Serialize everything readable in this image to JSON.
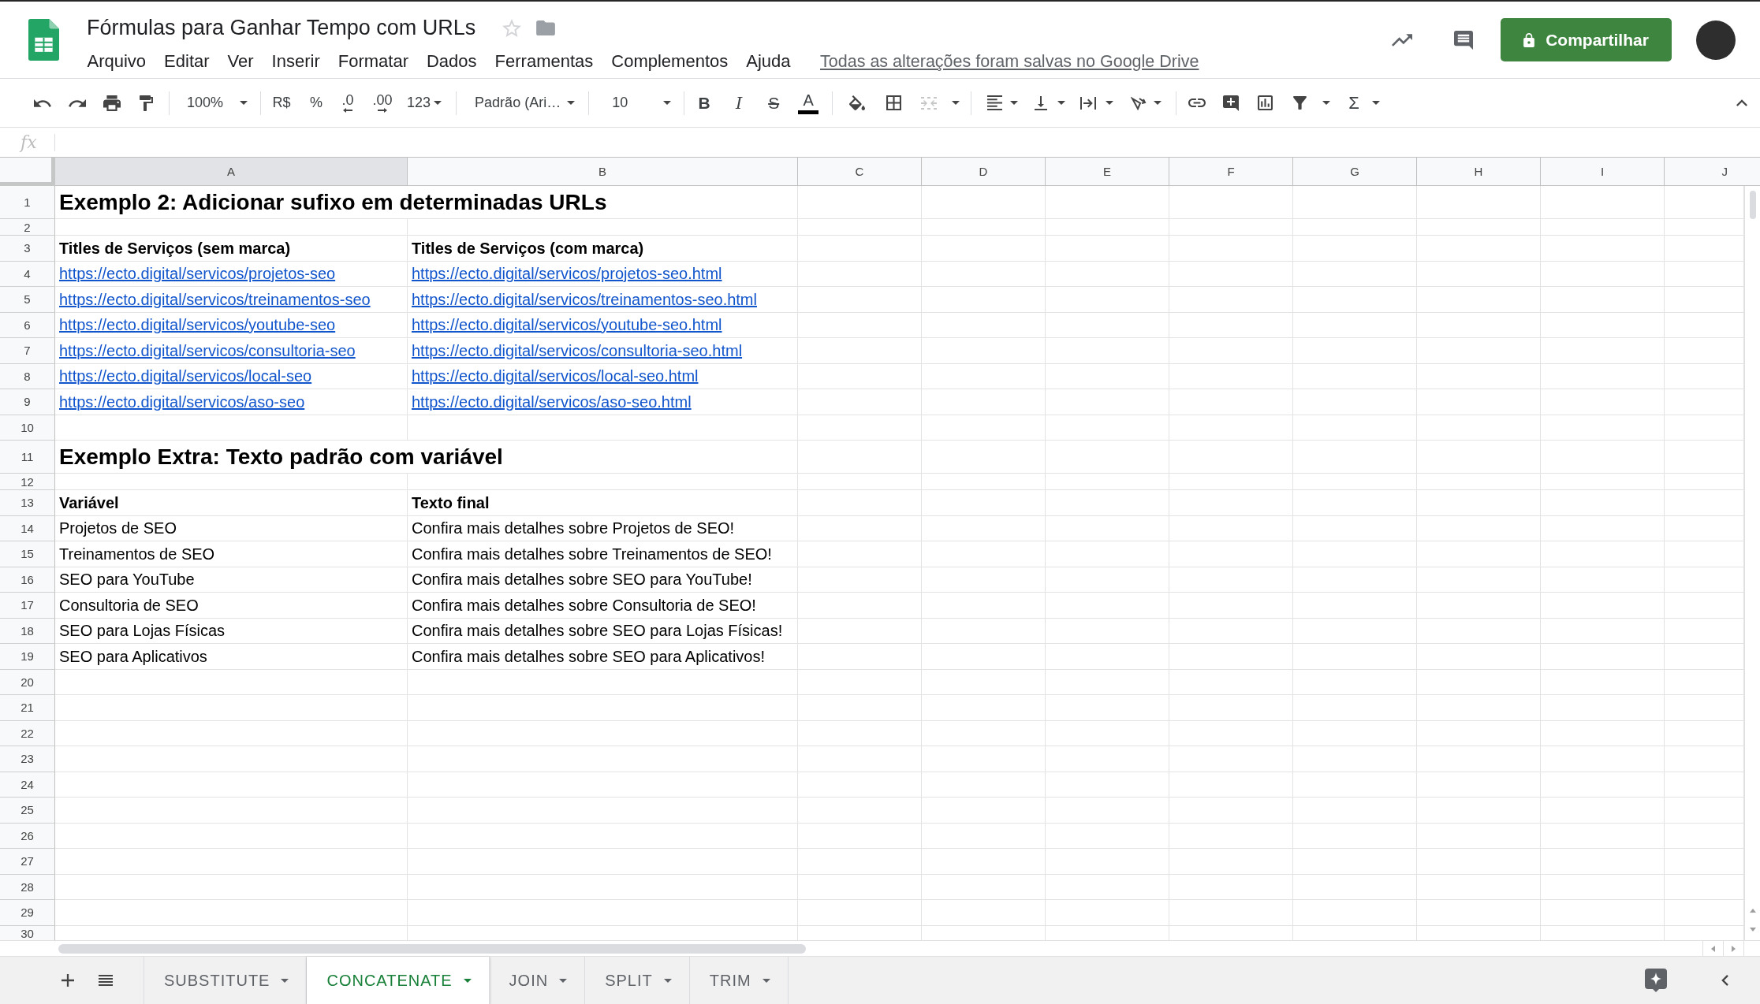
{
  "document": {
    "title": "Fórmulas para Ganhar Tempo com URLs",
    "starred": false,
    "menu": [
      "Arquivo",
      "Editar",
      "Ver",
      "Inserir",
      "Formatar",
      "Dados",
      "Ferramentas",
      "Complementos",
      "Ajuda"
    ],
    "save_status": "Todas as alterações foram salvas no Google Drive"
  },
  "share_button": {
    "label": "Compartilhar"
  },
  "toolbar": {
    "zoom": "100%",
    "currency": "R$",
    "percent": "%",
    "decrease_decimals": ".0",
    "increase_decimals": ".00",
    "number_format": "123",
    "font": "Padrão (Ari…",
    "font_size": "10",
    "bold": "B",
    "italic": "I",
    "strikethrough": "S",
    "text_color": "A",
    "merge_cells": {
      "disabled": true
    },
    "functions": "Σ"
  },
  "formula_bar": {
    "label": "fx"
  },
  "sheet": {
    "columns": [
      {
        "label": "A",
        "selected": true
      },
      {
        "label": "B",
        "selected": false
      },
      {
        "label": "C",
        "selected": false
      },
      {
        "label": "D",
        "selected": false
      },
      {
        "label": "E",
        "selected": false
      },
      {
        "label": "F",
        "selected": false
      },
      {
        "label": "G",
        "selected": false
      },
      {
        "label": "H",
        "selected": false
      },
      {
        "label": "I",
        "selected": false
      },
      {
        "label": "J",
        "selected": false
      }
    ],
    "rows": [
      {
        "number": "1",
        "kind": "title",
        "cells": [
          {
            "kind": "title",
            "text": "Exemplo 2: Adicionar sufixo em determinadas URLs"
          }
        ]
      },
      {
        "number": "2",
        "kind": "spacer"
      },
      {
        "number": "3",
        "kind": "data",
        "cells": [
          {
            "kind": "bold",
            "text": "Titles de Serviços (sem marca)"
          },
          {
            "kind": "bold",
            "text": "Titles de Serviços (com marca)"
          }
        ]
      },
      {
        "number": "4",
        "kind": "data",
        "cells": [
          {
            "kind": "link",
            "text": "https://ecto.digital/servicos/projetos-seo"
          },
          {
            "kind": "link",
            "text": "https://ecto.digital/servicos/projetos-seo.html"
          }
        ]
      },
      {
        "number": "5",
        "kind": "data",
        "cells": [
          {
            "kind": "link",
            "text": "https://ecto.digital/servicos/treinamentos-seo"
          },
          {
            "kind": "link",
            "text": "https://ecto.digital/servicos/treinamentos-seo.html"
          }
        ]
      },
      {
        "number": "6",
        "kind": "data",
        "cells": [
          {
            "kind": "link",
            "text": "https://ecto.digital/servicos/youtube-seo"
          },
          {
            "kind": "link",
            "text": "https://ecto.digital/servicos/youtube-seo.html"
          }
        ]
      },
      {
        "number": "7",
        "kind": "data",
        "cells": [
          {
            "kind": "link",
            "text": "https://ecto.digital/servicos/consultoria-seo"
          },
          {
            "kind": "link",
            "text": "https://ecto.digital/servicos/consultoria-seo.html"
          }
        ]
      },
      {
        "number": "8",
        "kind": "data",
        "cells": [
          {
            "kind": "link",
            "text": "https://ecto.digital/servicos/local-seo"
          },
          {
            "kind": "link",
            "text": "https://ecto.digital/servicos/local-seo.html"
          }
        ]
      },
      {
        "number": "9",
        "kind": "data",
        "cells": [
          {
            "kind": "link",
            "text": "https://ecto.digital/servicos/aso-seo"
          },
          {
            "kind": "link",
            "text": "https://ecto.digital/servicos/aso-seo.html"
          }
        ]
      },
      {
        "number": "10",
        "kind": "data"
      },
      {
        "number": "11",
        "kind": "title",
        "cells": [
          {
            "kind": "title",
            "text": "Exemplo Extra: Texto padrão com variável"
          }
        ]
      },
      {
        "number": "12",
        "kind": "spacer"
      },
      {
        "number": "13",
        "kind": "data",
        "cells": [
          {
            "kind": "bold",
            "text": "Variável"
          },
          {
            "kind": "bold",
            "text": "Texto final"
          }
        ]
      },
      {
        "number": "14",
        "kind": "data",
        "cells": [
          {
            "kind": "text",
            "text": "Projetos de SEO"
          },
          {
            "kind": "text",
            "text": "Confira mais detalhes sobre Projetos de SEO!"
          }
        ]
      },
      {
        "number": "15",
        "kind": "data",
        "cells": [
          {
            "kind": "text",
            "text": "Treinamentos de SEO"
          },
          {
            "kind": "text",
            "text": "Confira mais detalhes sobre Treinamentos de SEO!"
          }
        ]
      },
      {
        "number": "16",
        "kind": "data",
        "cells": [
          {
            "kind": "text",
            "text": "SEO para YouTube"
          },
          {
            "kind": "text",
            "text": "Confira mais detalhes sobre SEO para YouTube!"
          }
        ]
      },
      {
        "number": "17",
        "kind": "data",
        "cells": [
          {
            "kind": "text",
            "text": "Consultoria de SEO"
          },
          {
            "kind": "text",
            "text": "Confira mais detalhes sobre Consultoria de SEO!"
          }
        ]
      },
      {
        "number": "18",
        "kind": "data",
        "cells": [
          {
            "kind": "text",
            "text": "SEO para Lojas Físicas"
          },
          {
            "kind": "text",
            "text": "Confira mais detalhes sobre SEO para Lojas Físicas!"
          }
        ]
      },
      {
        "number": "19",
        "kind": "data",
        "cells": [
          {
            "kind": "text",
            "text": "SEO para Aplicativos"
          },
          {
            "kind": "text",
            "text": "Confira mais detalhes sobre SEO para Aplicativos!"
          }
        ]
      },
      {
        "number": "20",
        "kind": "data"
      },
      {
        "number": "21",
        "kind": "data"
      },
      {
        "number": "22",
        "kind": "data"
      },
      {
        "number": "23",
        "kind": "data"
      },
      {
        "number": "24",
        "kind": "data"
      },
      {
        "number": "25",
        "kind": "data"
      },
      {
        "number": "26",
        "kind": "data"
      },
      {
        "number": "27",
        "kind": "data"
      },
      {
        "number": "28",
        "kind": "data"
      },
      {
        "number": "29",
        "kind": "data"
      },
      {
        "number": "30",
        "kind": "data"
      }
    ]
  },
  "sheet_tabs": [
    {
      "label": "SUBSTITUTE",
      "selected": false
    },
    {
      "label": "CONCATENATE",
      "selected": true
    },
    {
      "label": "JOIN",
      "selected": false
    },
    {
      "label": "SPLIT",
      "selected": false
    },
    {
      "label": "TRIM",
      "selected": false
    }
  ]
}
